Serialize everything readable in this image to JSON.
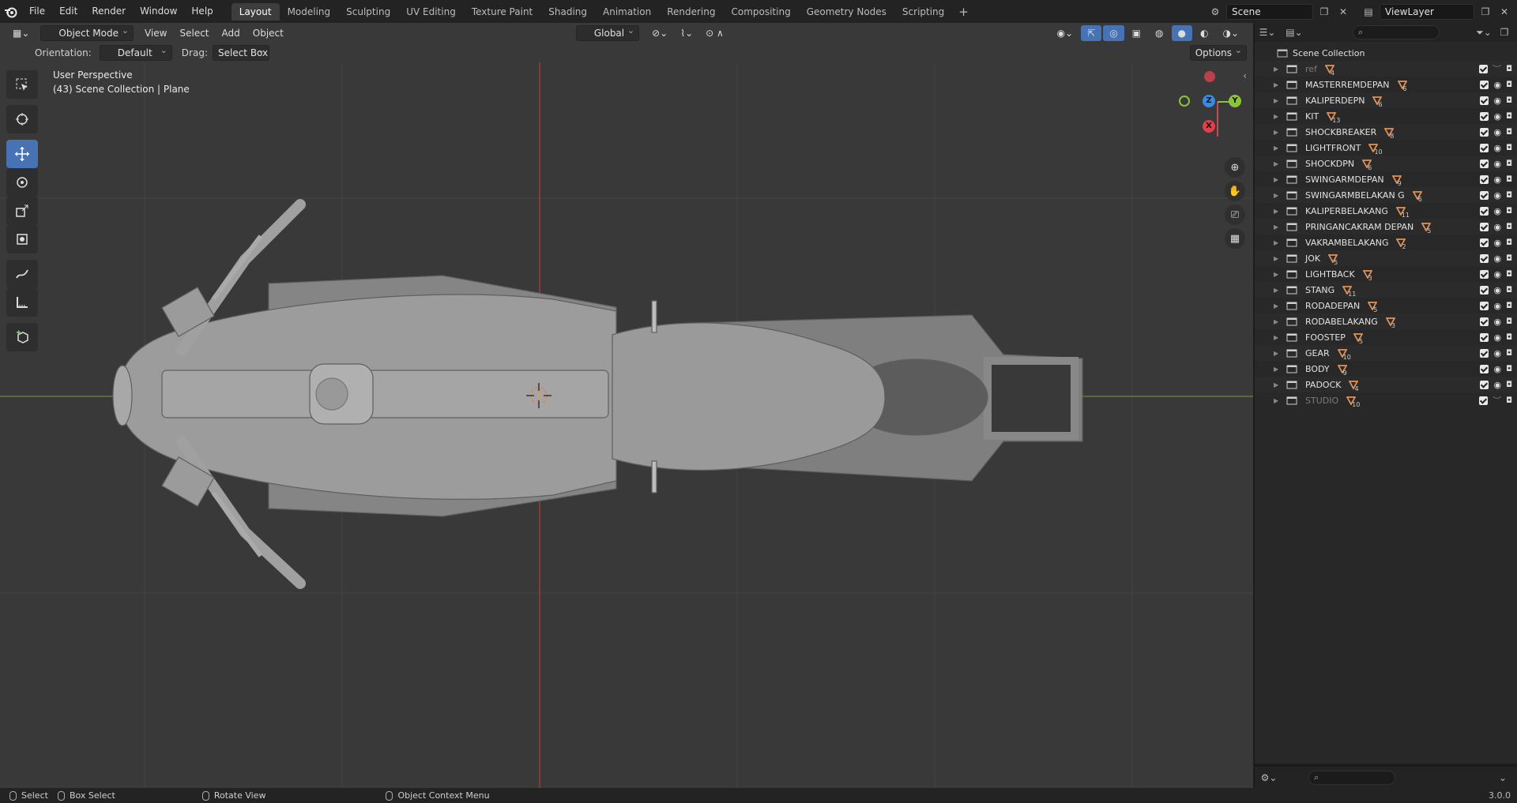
{
  "menu": [
    "File",
    "Edit",
    "Render",
    "Window",
    "Help"
  ],
  "workspace_tabs": [
    "Layout",
    "Modeling",
    "Sculpting",
    "UV Editing",
    "Texture Paint",
    "Shading",
    "Animation",
    "Rendering",
    "Compositing",
    "Geometry Nodes",
    "Scripting"
  ],
  "active_workspace": "Layout",
  "scene": {
    "name": "Scene",
    "view_layer": "ViewLayer"
  },
  "viewport": {
    "mode": "Object Mode",
    "menus": [
      "View",
      "Select",
      "Add",
      "Object"
    ],
    "transform_orientation": "Global",
    "orientation_label": "Orientation:",
    "orientation_value": "Default",
    "drag_label": "Drag:",
    "drag_value": "Select Box",
    "options_label": "Options",
    "perspective": "User Perspective",
    "context": "(43) Scene Collection | Plane",
    "gizmo_axes": {
      "z": "Z",
      "y": "Y",
      "x": "X"
    }
  },
  "toolbar_tools": [
    "select-box",
    "cursor",
    "move",
    "rotate",
    "scale",
    "transform",
    "annotate",
    "measure",
    "add-cube"
  ],
  "outliner": {
    "root": "Scene Collection",
    "collections": [
      {
        "name": "ref",
        "count": "4",
        "dim": true
      },
      {
        "name": "MASTERREMDEPAN",
        "count": "6"
      },
      {
        "name": "KALIPERDEPN",
        "count": "6"
      },
      {
        "name": "KIT",
        "count": "13"
      },
      {
        "name": "SHOCKBREAKER",
        "count": "8"
      },
      {
        "name": "LIGHTFRONT",
        "count": "10"
      },
      {
        "name": "SHOCKDPN",
        "count": "6"
      },
      {
        "name": "SWINGARMDEPAN",
        "count": "9"
      },
      {
        "name": "SWINGARMBELAKAN G",
        "count": "6"
      },
      {
        "name": "KALIPERBELAKANG",
        "count": "11"
      },
      {
        "name": "PRINGANCAKRAM DEPAN",
        "count": "5"
      },
      {
        "name": "VAKRAMBELAKANG",
        "count": "2"
      },
      {
        "name": "JOK",
        "count": "5"
      },
      {
        "name": "LIGHTBACK",
        "count": "3"
      },
      {
        "name": "STANG",
        "count": "11"
      },
      {
        "name": "RODADEPAN",
        "count": "5"
      },
      {
        "name": "RODABELAKANG",
        "count": "3"
      },
      {
        "name": "FOOSTEP",
        "count": "5"
      },
      {
        "name": "GEAR",
        "count": "10"
      },
      {
        "name": "BODY",
        "count": "9"
      },
      {
        "name": "PADOCK",
        "count": "4"
      },
      {
        "name": "STUDIO",
        "count": "10",
        "dim": true
      }
    ]
  },
  "statusbar": {
    "select": "Select",
    "box_select": "Box Select",
    "rotate_view": "Rotate View",
    "context_menu": "Object Context Menu",
    "version": "3.0.0"
  },
  "colors": {
    "accent": "#4772b3",
    "axis_x": "#e0404c",
    "axis_y": "#8bc43a",
    "axis_z": "#3b8ae0",
    "mesh_icon": "#e0935a"
  }
}
